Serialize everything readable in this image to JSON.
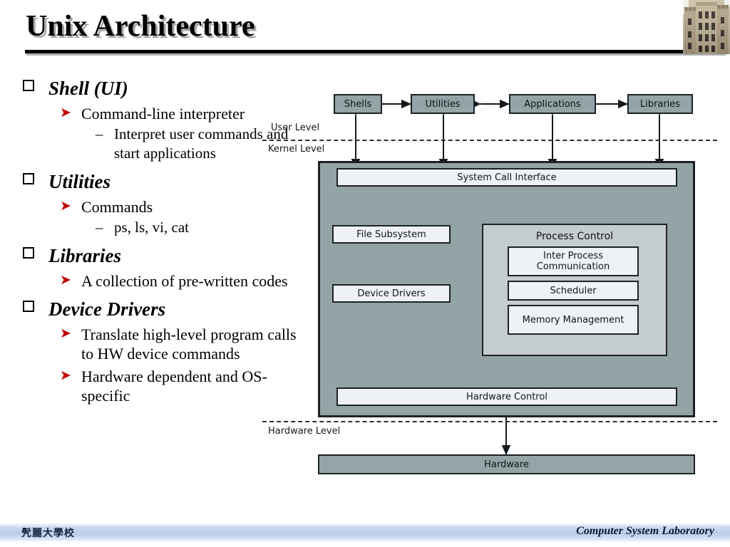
{
  "slide": {
    "title": "Unix Architecture"
  },
  "decor": {
    "castle_photo": "castle-photo",
    "title_rule": "title-underline"
  },
  "bullets": [
    {
      "level": 1,
      "marker": "hollow-square",
      "text": "Shell (UI)",
      "children": [
        {
          "level": 2,
          "marker": "red-arrow",
          "text": "Command-line interpreter",
          "children": [
            {
              "level": 3,
              "marker": "en-dash",
              "text": "Interpret user commands and start applications"
            }
          ]
        }
      ]
    },
    {
      "level": 1,
      "marker": "hollow-square",
      "text": "Utilities",
      "children": [
        {
          "level": 2,
          "marker": "red-arrow",
          "text": "Commands",
          "children": [
            {
              "level": 3,
              "marker": "en-dash",
              "text": "ps, ls, vi, cat"
            }
          ]
        }
      ]
    },
    {
      "level": 1,
      "marker": "hollow-square",
      "text": "Libraries",
      "children": [
        {
          "level": 2,
          "marker": "red-arrow",
          "text": "A collection of pre-written codes",
          "children": []
        }
      ]
    },
    {
      "level": 1,
      "marker": "hollow-square",
      "text": "Device Drivers",
      "children": [
        {
          "level": 2,
          "marker": "red-arrow",
          "text": "Translate high-level program calls to HW device commands",
          "children": []
        },
        {
          "level": 2,
          "marker": "red-arrow",
          "text": "Hardware dependent and OS-specific",
          "children": []
        }
      ]
    }
  ],
  "diagram": {
    "type": "block-diagram",
    "user_level_boxes": [
      {
        "label": "Shells"
      },
      {
        "label": "Utilities"
      },
      {
        "label": "Applications"
      },
      {
        "label": "Libraries"
      }
    ],
    "level_labels": {
      "user": "User Level",
      "kernel": "Kernel Level",
      "hardware": "Hardware Level"
    },
    "kernel": {
      "system_call_interface": "System Call Interface",
      "file_subsystem": "File Subsystem",
      "device_drivers": "Device Drivers",
      "process_control": {
        "label": "Process Control",
        "items": [
          "Inter Process Communication",
          "Scheduler",
          "Memory Management"
        ]
      },
      "hardware_control": "Hardware Control"
    },
    "hardware_box": "Hardware",
    "colors": {
      "box_gray": "#93a3a6",
      "box_white": "#eef2f6",
      "process_control_gray": "#c4ccce",
      "border": "#1b2226"
    }
  },
  "footer": {
    "left": "髠麗大學校",
    "right": "Computer System Laboratory"
  }
}
